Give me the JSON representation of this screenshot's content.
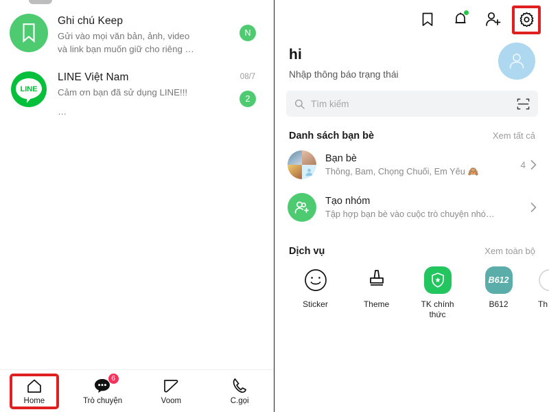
{
  "app": {
    "name": "LINE",
    "accent_green": "#4ecb71",
    "highlight_red": "#e02020",
    "badge_red": "#f2335c"
  },
  "left_panel": {
    "chats": [
      {
        "icon": "bookmark-icon",
        "title": "Ghi chú Keep",
        "snippet_line1": "Gửi vào mọi văn bản, ảnh, video",
        "snippet_line2": "và link bạn muốn giữ cho riêng …",
        "time": "",
        "badge": "N"
      },
      {
        "icon": "line-logo-icon",
        "title": "LINE Việt Nam",
        "snippet_line1": "Cảm ơn bạn đã sử dụng LINE!!!",
        "snippet_line2": "…",
        "time": "08/7",
        "badge": "2"
      }
    ],
    "bottom_nav": [
      {
        "label": "Home",
        "icon": "home-icon",
        "badge": "",
        "selected": true
      },
      {
        "label": "Trò chuyện",
        "icon": "chat-icon",
        "badge": "6",
        "selected": false
      },
      {
        "label": "Voom",
        "icon": "voom-icon",
        "badge": "",
        "selected": false
      },
      {
        "label": "C.gọi",
        "icon": "phone-icon",
        "badge": "",
        "selected": false
      }
    ]
  },
  "right_panel": {
    "topbar_icons": [
      {
        "name": "bookmark-icon",
        "has_dot": false,
        "highlighted": false
      },
      {
        "name": "bell-icon",
        "has_dot": true,
        "highlighted": false
      },
      {
        "name": "add-friend-icon",
        "has_dot": false,
        "highlighted": false
      },
      {
        "name": "gear-icon",
        "has_dot": false,
        "highlighted": true
      }
    ],
    "profile": {
      "name": "hi",
      "status": "Nhập thông báo trạng thái",
      "avatar": "person-placeholder-icon"
    },
    "search": {
      "placeholder": "Tìm kiếm",
      "icon": "search-icon",
      "qr_icon": "qr-scan-icon"
    },
    "friends_section": {
      "title": "Danh sách bạn bè",
      "link": "Xem tất cả",
      "rows": [
        {
          "icon": "friends-grid-avatar",
          "title": "Bạn bè",
          "subtitle": "Thông, Bam, Chọng Chuối, Em Yêu 🙈",
          "count": "4",
          "chevron": "chevron-right-icon"
        },
        {
          "icon": "create-group-icon",
          "title": "Tạo nhóm",
          "subtitle": "Tập hợp bạn bè vào cuộc trò chuyện nhó…",
          "count": "",
          "chevron": "chevron-right-icon"
        }
      ]
    },
    "services_section": {
      "title": "Dịch vụ",
      "link": "Xem toàn bộ",
      "items": [
        {
          "label": "Sticker",
          "icon": "smiley-icon"
        },
        {
          "label": "Theme",
          "icon": "brush-icon"
        },
        {
          "label": "TK chính thức",
          "icon": "shield-check-icon"
        },
        {
          "label": "B612",
          "icon": "b612-icon",
          "badge_text": "B612"
        },
        {
          "label": "Th",
          "icon": "cut-off-icon"
        }
      ]
    }
  }
}
